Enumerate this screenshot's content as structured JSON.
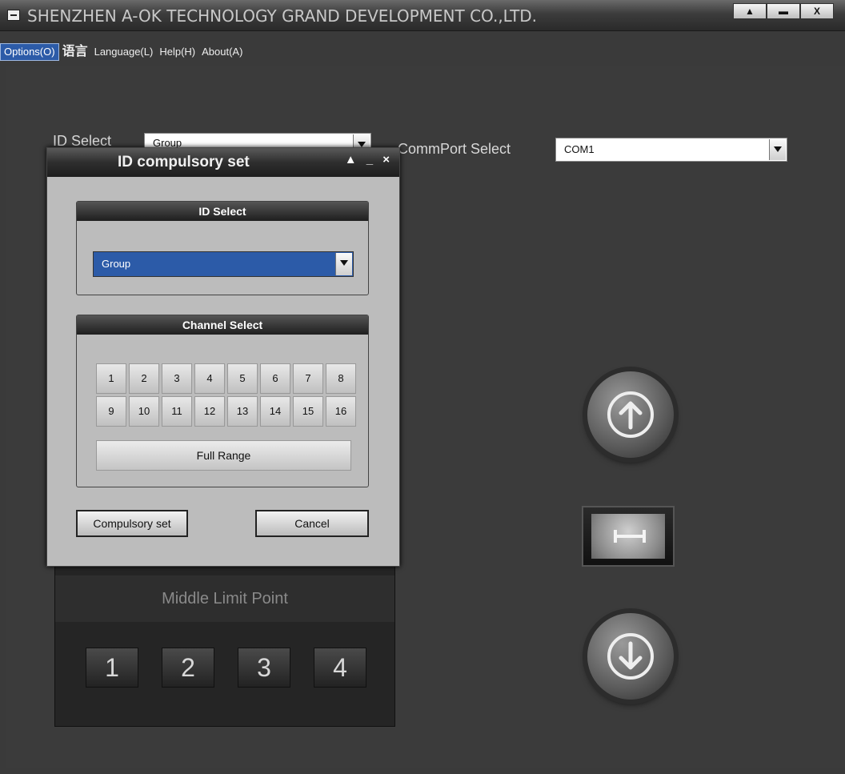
{
  "window": {
    "title": "SHENZHEN A-OK TECHNOLOGY GRAND DEVELOPMENT CO.,LTD.",
    "controls": {
      "restore": "▲",
      "minimize": "▬",
      "close": "X"
    }
  },
  "menubar": {
    "items": [
      "Options(O)",
      "语言",
      "Language(L)",
      "Help(H)",
      "About(A)"
    ]
  },
  "main": {
    "id_select_label": "ID Select",
    "id_select_value": "Group",
    "commport_label": "CommPort Select",
    "commport_value": "COM1"
  },
  "limit_panel": {
    "title": "Middle Limit Point",
    "buttons": [
      "1",
      "2",
      "3",
      "4"
    ]
  },
  "dialog": {
    "title": "ID compulsory set",
    "controls": "▲ _ ×",
    "id_group_title": "ID Select",
    "id_value": "Group",
    "channel_group_title": "Channel Select",
    "channels": [
      "1",
      "2",
      "3",
      "4",
      "5",
      "6",
      "7",
      "8",
      "9",
      "10",
      "11",
      "12",
      "13",
      "14",
      "15",
      "16"
    ],
    "full_range_label": "Full Range",
    "compulsory_set_label": "Compulsory set",
    "cancel_label": "Cancel"
  },
  "colors": {
    "background": "#3a3a3a",
    "dialog_bg": "#bcbcbc",
    "selection_blue": "#2c5ba8"
  },
  "icons": [
    "up-arrow-icon",
    "down-arrow-icon",
    "stop-icon",
    "dropdown-arrow-icon",
    "window-menu-icon"
  ]
}
